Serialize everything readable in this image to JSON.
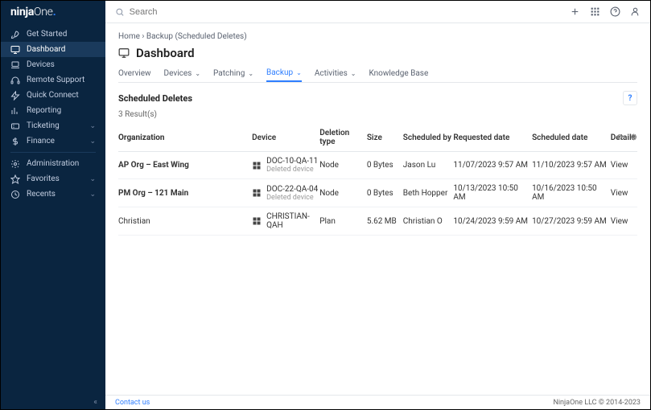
{
  "brand": {
    "name": "ninjaOne",
    "dot": "."
  },
  "search": {
    "placeholder": "Search"
  },
  "sidebar": {
    "items": [
      {
        "label": "Get Started",
        "icon": "rocket"
      },
      {
        "label": "Dashboard",
        "icon": "monitor",
        "active": true
      },
      {
        "label": "Devices",
        "icon": "laptop"
      },
      {
        "label": "Remote Support",
        "icon": "headset"
      },
      {
        "label": "Quick Connect",
        "icon": "bolt"
      },
      {
        "label": "Reporting",
        "icon": "chart"
      },
      {
        "label": "Ticketing",
        "icon": "ticket",
        "chevron": true
      },
      {
        "label": "Finance",
        "icon": "dollar",
        "chevron": true
      }
    ],
    "lower": [
      {
        "label": "Administration",
        "icon": "gear"
      },
      {
        "label": "Favorites",
        "icon": "star",
        "chevron": true
      },
      {
        "label": "Recents",
        "icon": "clock",
        "chevron": true
      }
    ]
  },
  "breadcrumb": {
    "home": "Home",
    "sep": " › ",
    "current": "Backup (Scheduled Deletes)"
  },
  "title": "Dashboard",
  "tabs": [
    {
      "label": "Overview"
    },
    {
      "label": "Devices",
      "dropdown": true
    },
    {
      "label": "Patching",
      "dropdown": true
    },
    {
      "label": "Backup",
      "dropdown": true,
      "active": true
    },
    {
      "label": "Activities",
      "dropdown": true
    },
    {
      "label": "Knowledge Base"
    }
  ],
  "section": {
    "title": "Scheduled Deletes",
    "count": "3 Result(s)"
  },
  "columns": {
    "org": "Organization",
    "device": "Device",
    "dtype": "Deletion type",
    "size": "Size",
    "by": "Scheduled by",
    "rdate": "Requested date",
    "sdate": "Scheduled date",
    "details": "Details"
  },
  "rows": [
    {
      "org": "AP Org – East Wing",
      "device": "DOC-10-QA-11",
      "device_sub": "Deleted device",
      "dtype": "Node",
      "size": "0 Bytes",
      "by": "Jason Lu",
      "rdate": "11/07/2023 9:57 AM",
      "sdate": "11/10/2023 9:57 AM",
      "details": "View",
      "bold": true
    },
    {
      "org": "PM Org – 121 Main",
      "device": "DOC-22-QA-04",
      "device_sub": "Deleted device",
      "dtype": "Node",
      "size": "0 Bytes",
      "by": "Beth Hopper",
      "rdate": "10/13/2023 10:50 AM",
      "sdate": "10/16/2023 10:50 AM",
      "details": "View",
      "bold": true
    },
    {
      "org": "Christian",
      "device": "CHRISTIAN-QAH",
      "device_sub": "",
      "dtype": "Plan",
      "size": "5.62 MB",
      "by": "Christian O",
      "rdate": "10/24/2023 9:59 AM",
      "sdate": "10/27/2023 9:59 AM",
      "details": "View",
      "bold": false
    }
  ],
  "footer": {
    "contact": "Contact us",
    "copy": "NinjaOne LLC © 2014-2023"
  }
}
